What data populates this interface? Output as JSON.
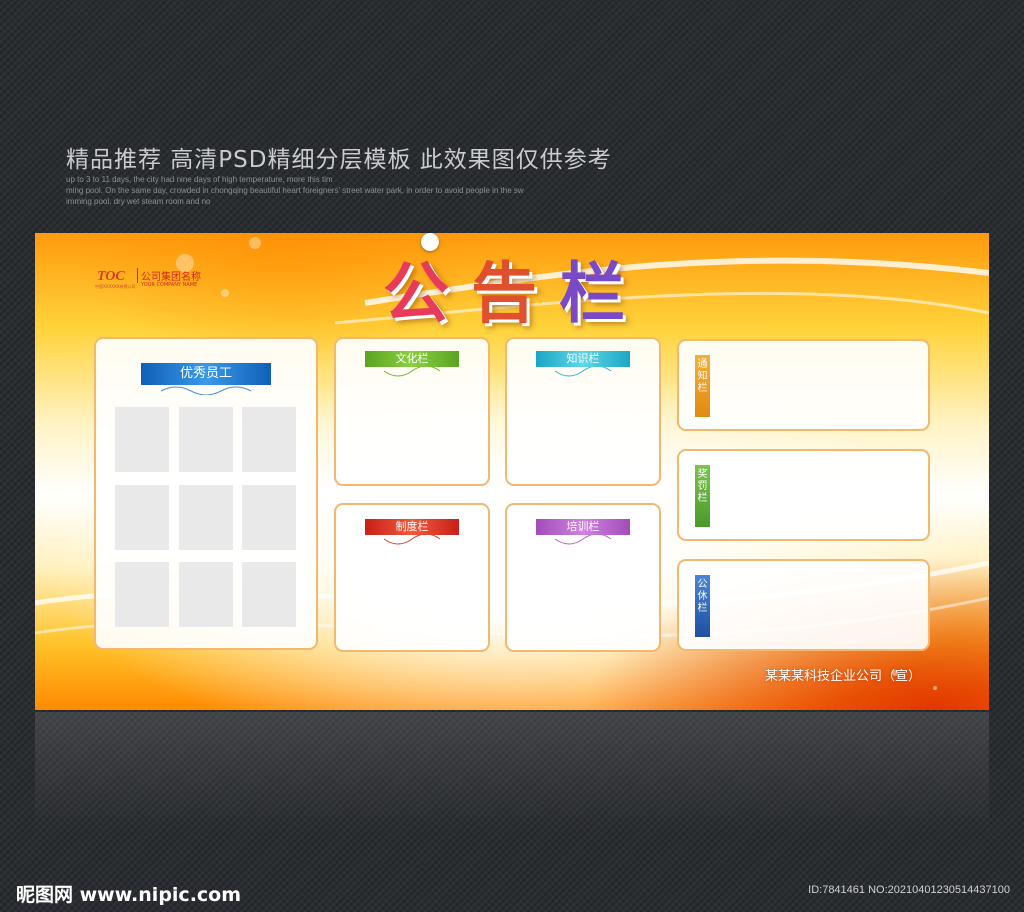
{
  "promo": {
    "headline": "精品推荐 高清PSD精细分层模板 此效果图仅供参考",
    "lines": [
      "up to 3 to 11 days, the city had nine days of high temperature, more this tim",
      "ming pool. On the same day, crowded in chongqing beautiful heart foreigners' street water park, in order to avoid people in the sw",
      "imming pool, dry wet steam room and no"
    ]
  },
  "board": {
    "logo_mark": "TOC",
    "logo_sub": "中国XXXXXX有限公司",
    "logo_name": "公司集团名称",
    "logo_en": "YOUR COMPANY NAME",
    "title_chars": [
      "公",
      "告",
      "栏"
    ],
    "sections": {
      "staff": "优秀员工",
      "culture": "文化栏",
      "knowledge": "知识栏",
      "system": "制度栏",
      "training": "培训栏",
      "notice": "通知栏",
      "reward": "奖罚栏",
      "leisure": "公休栏"
    },
    "company": "某某某科技企业公司（宣）"
  },
  "colors": {
    "staff": "#1a6fc4",
    "culture": "#6ab42d",
    "knowledge": "#2bb6cf",
    "system": "#e0322a",
    "training": "#b45ec8",
    "notice": "#f0a020",
    "reward": "#5aa83a",
    "leisure": "#2d66b8"
  },
  "footer": {
    "watermark": "昵图网 www.nipic.com",
    "id": "ID:7841461 NO:20210401230514437100"
  }
}
